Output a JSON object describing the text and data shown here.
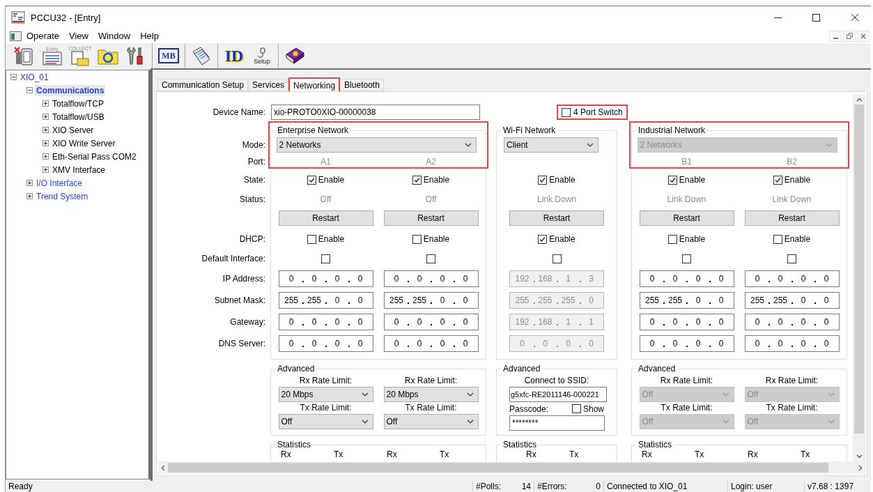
{
  "window": {
    "title": "PCCU32 - [Entry]"
  },
  "menu": [
    "Operate",
    "View",
    "Window",
    "Help"
  ],
  "toolbar": [
    [
      {
        "kind": "device"
      },
      {
        "kind": "entry",
        "label": "Entry"
      },
      {
        "kind": "collect",
        "label": "COLLECT"
      },
      {
        "kind": "refresh"
      },
      {
        "kind": "tools"
      }
    ],
    [
      {
        "kind": "mb",
        "label": "MB"
      }
    ],
    [
      {
        "kind": "pages"
      }
    ],
    [
      {
        "kind": "id",
        "label": "ID"
      },
      {
        "kind": "setup",
        "label": "Setup"
      }
    ],
    [
      {
        "kind": "book"
      }
    ]
  ],
  "tree": [
    {
      "label": "XIO_01",
      "expanded": true,
      "selected": false,
      "children": [
        {
          "label": "Communications",
          "expanded": true,
          "selected": true,
          "children": [
            {
              "label": "Totalflow/TCP",
              "expanded": false,
              "selected": false
            },
            {
              "label": "Totalflow/USB",
              "expanded": false,
              "selected": false
            },
            {
              "label": "XIO Server",
              "expanded": false,
              "selected": false
            },
            {
              "label": "XIO Write Server",
              "expanded": false,
              "selected": false
            },
            {
              "label": "Eth-Serial Pass COM2",
              "expanded": false,
              "selected": false
            },
            {
              "label": "XMV Interface",
              "expanded": false,
              "selected": false
            }
          ]
        },
        {
          "label": "I/O Interface",
          "expanded": false,
          "selected": false
        },
        {
          "label": "Trend System",
          "expanded": false,
          "selected": false
        }
      ]
    }
  ],
  "tabs": [
    {
      "label": "Communication Setup",
      "selected": false,
      "highlighted": false
    },
    {
      "label": "Services",
      "selected": false,
      "highlighted": false
    },
    {
      "label": "Networking",
      "selected": true,
      "highlighted": true
    },
    {
      "label": "Bluetooth",
      "selected": false,
      "highlighted": false
    }
  ],
  "device_name": {
    "label": "Device Name:",
    "value": "xio-PROTO0XIO-00000038"
  },
  "port_switch": {
    "label": "4 Port Switch",
    "checked": false,
    "highlighted": true
  },
  "row_labels": {
    "mode": "Mode:",
    "port": "Port:",
    "state": "State:",
    "status": "Status:",
    "dhcp": "DHCP:",
    "default_interface": "Default Interface:",
    "ip_address": "IP Address:",
    "subnet_mask": "Subnet Mask:",
    "gateway": "Gateway:",
    "dns_server": "DNS Server:"
  },
  "networks": [
    {
      "title": "Enterprise Network",
      "highlighted": true,
      "mode": {
        "value": "2 Networks",
        "disabled": false
      },
      "ports": [
        {
          "port": "A1",
          "state_checked": true,
          "state_label": "Enable",
          "status": "Off",
          "restart": "Restart",
          "dhcp_checked": false,
          "dhcp_label": "Enable",
          "default_checked": false,
          "address_disabled": false,
          "ip_address": [
            "0",
            "0",
            "0",
            "0"
          ],
          "subnet_mask": [
            "255",
            "255",
            "0",
            "0"
          ],
          "gateway": [
            "0",
            "0",
            "0",
            "0"
          ],
          "dns_server": [
            "0",
            "0",
            "0",
            "0"
          ]
        },
        {
          "port": "A2",
          "state_checked": true,
          "state_label": "Enable",
          "status": "Off",
          "restart": "Restart",
          "dhcp_checked": false,
          "dhcp_label": "Enable",
          "default_checked": false,
          "address_disabled": false,
          "ip_address": [
            "0",
            "0",
            "0",
            "0"
          ],
          "subnet_mask": [
            "255",
            "255",
            "0",
            "0"
          ],
          "gateway": [
            "0",
            "0",
            "0",
            "0"
          ],
          "dns_server": [
            "0",
            "0",
            "0",
            "0"
          ]
        }
      ],
      "advanced": {
        "kind": "rates",
        "title": "Advanced",
        "ports": [
          {
            "rx_label": "Rx Rate Limit:",
            "rx": "20 Mbps",
            "tx_label": "Tx Rate Limit:",
            "tx": "Off",
            "disabled": false
          },
          {
            "rx_label": "Rx Rate Limit:",
            "rx": "20 Mbps",
            "tx_label": "Tx Rate Limit:",
            "tx": "Off",
            "disabled": false
          }
        ]
      },
      "statistics": {
        "title": "Statistics",
        "columns": [
          "Rx",
          "Tx",
          "Rx",
          "Tx"
        ]
      }
    },
    {
      "title": "Wi-Fi Network",
      "mode": {
        "value": "Client",
        "disabled": false
      },
      "ports": [
        {
          "state_checked": true,
          "state_label": "Enable",
          "status": "Link Down",
          "restart": "Restart",
          "dhcp_checked": true,
          "dhcp_label": "Enable",
          "default_checked": false,
          "address_disabled": true,
          "ip_address": [
            "192",
            "168",
            "1",
            "3"
          ],
          "subnet_mask": [
            "255",
            "255",
            "255",
            "0"
          ],
          "gateway": [
            "192",
            "168",
            "1",
            "1"
          ],
          "dns_server": [
            "0",
            "0",
            "0",
            "0"
          ]
        }
      ],
      "advanced": {
        "kind": "wifi",
        "title": "Advanced",
        "ssid_label": "Connect to SSID:",
        "ssid": "g5xfc-RE2011146-000221",
        "passcode_label": "Passcode:",
        "passcode": "********",
        "show_label": "Show",
        "show_checked": false
      },
      "statistics": {
        "title": "Statistics",
        "columns": [
          "Rx",
          "Tx"
        ]
      }
    },
    {
      "title": "Industrial Network",
      "highlighted": true,
      "mode": {
        "value": "2 Networks",
        "disabled": true
      },
      "ports": [
        {
          "port": "B1",
          "state_checked": true,
          "state_label": "Enable",
          "status": "Link Down",
          "restart": "Restart",
          "dhcp_checked": false,
          "dhcp_label": "Enable",
          "default_checked": false,
          "address_disabled": false,
          "ip_address": [
            "0",
            "0",
            "0",
            "0"
          ],
          "subnet_mask": [
            "255",
            "255",
            "0",
            "0"
          ],
          "gateway": [
            "0",
            "0",
            "0",
            "0"
          ],
          "dns_server": [
            "0",
            "0",
            "0",
            "0"
          ]
        },
        {
          "port": "B2",
          "state_checked": true,
          "state_label": "Enable",
          "status": "Link Down",
          "restart": "Restart",
          "dhcp_checked": false,
          "dhcp_label": "Enable",
          "default_checked": false,
          "address_disabled": false,
          "ip_address": [
            "0",
            "0",
            "0",
            "0"
          ],
          "subnet_mask": [
            "255",
            "255",
            "0",
            "0"
          ],
          "gateway": [
            "0",
            "0",
            "0",
            "0"
          ],
          "dns_server": [
            "0",
            "0",
            "0",
            "0"
          ]
        }
      ],
      "advanced": {
        "kind": "rates",
        "title": "Advanced",
        "ports": [
          {
            "rx_label": "Rx Rate Limit:",
            "rx": "Off",
            "tx_label": "Tx Rate Limit:",
            "tx": "Off",
            "disabled": true
          },
          {
            "rx_label": "Rx Rate Limit:",
            "rx": "Off",
            "tx_label": "Tx Rate Limit:",
            "tx": "Off",
            "disabled": true
          }
        ]
      },
      "statistics": {
        "title": "Statistics",
        "columns": [
          "Rx",
          "Tx",
          "Rx",
          "Tx"
        ]
      }
    }
  ],
  "status_bar": [
    {
      "value": "Ready"
    },
    {
      "label": "#Polls:",
      "value": "14"
    },
    {
      "label": "#Errors:",
      "value": "0"
    },
    {
      "value": "Connected to XIO_01"
    },
    {
      "value": "Login: user"
    },
    {
      "value": "v7.68 : 1397"
    }
  ]
}
